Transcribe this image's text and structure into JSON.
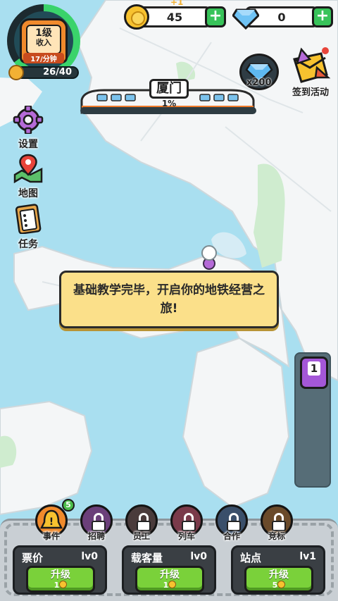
{
  "player": {
    "level": "1级",
    "income_label": "收入",
    "income_rate": "17/分钟",
    "xp_text": "26/40",
    "level_progress": 0.65
  },
  "currency": {
    "gain_hint": "+1",
    "coins": "45",
    "gems": "0"
  },
  "city": {
    "name": "厦门",
    "progress_text": "1%"
  },
  "rewards": {
    "gem_reward": "x200",
    "checkin_label": "签到活动"
  },
  "side_menu": {
    "settings": "设置",
    "map": "地图",
    "tasks": "任务"
  },
  "dialog": {
    "message": "基础教学完毕，开启你的地铁经营之旅!"
  },
  "right_panel": {
    "train_count": "1"
  },
  "features": [
    {
      "label": "事件",
      "badge": "5"
    },
    {
      "label": "招聘"
    },
    {
      "label": "员工"
    },
    {
      "label": "列车"
    },
    {
      "label": "合作"
    },
    {
      "label": "竞标"
    }
  ],
  "upgrades": [
    {
      "title": "票价",
      "level": "lv0",
      "button": "升级",
      "cost": "1"
    },
    {
      "title": "载客量",
      "level": "lv0",
      "button": "升级",
      "cost": "1"
    },
    {
      "title": "站点",
      "level": "lv1",
      "button": "升级",
      "cost": "5"
    }
  ],
  "colors": {
    "sea": "#a9dff0",
    "land": "#f4f6f7",
    "park": "#cfeccf",
    "accent_green": "#38c35a",
    "dialog_bg": "#fbe08a"
  }
}
